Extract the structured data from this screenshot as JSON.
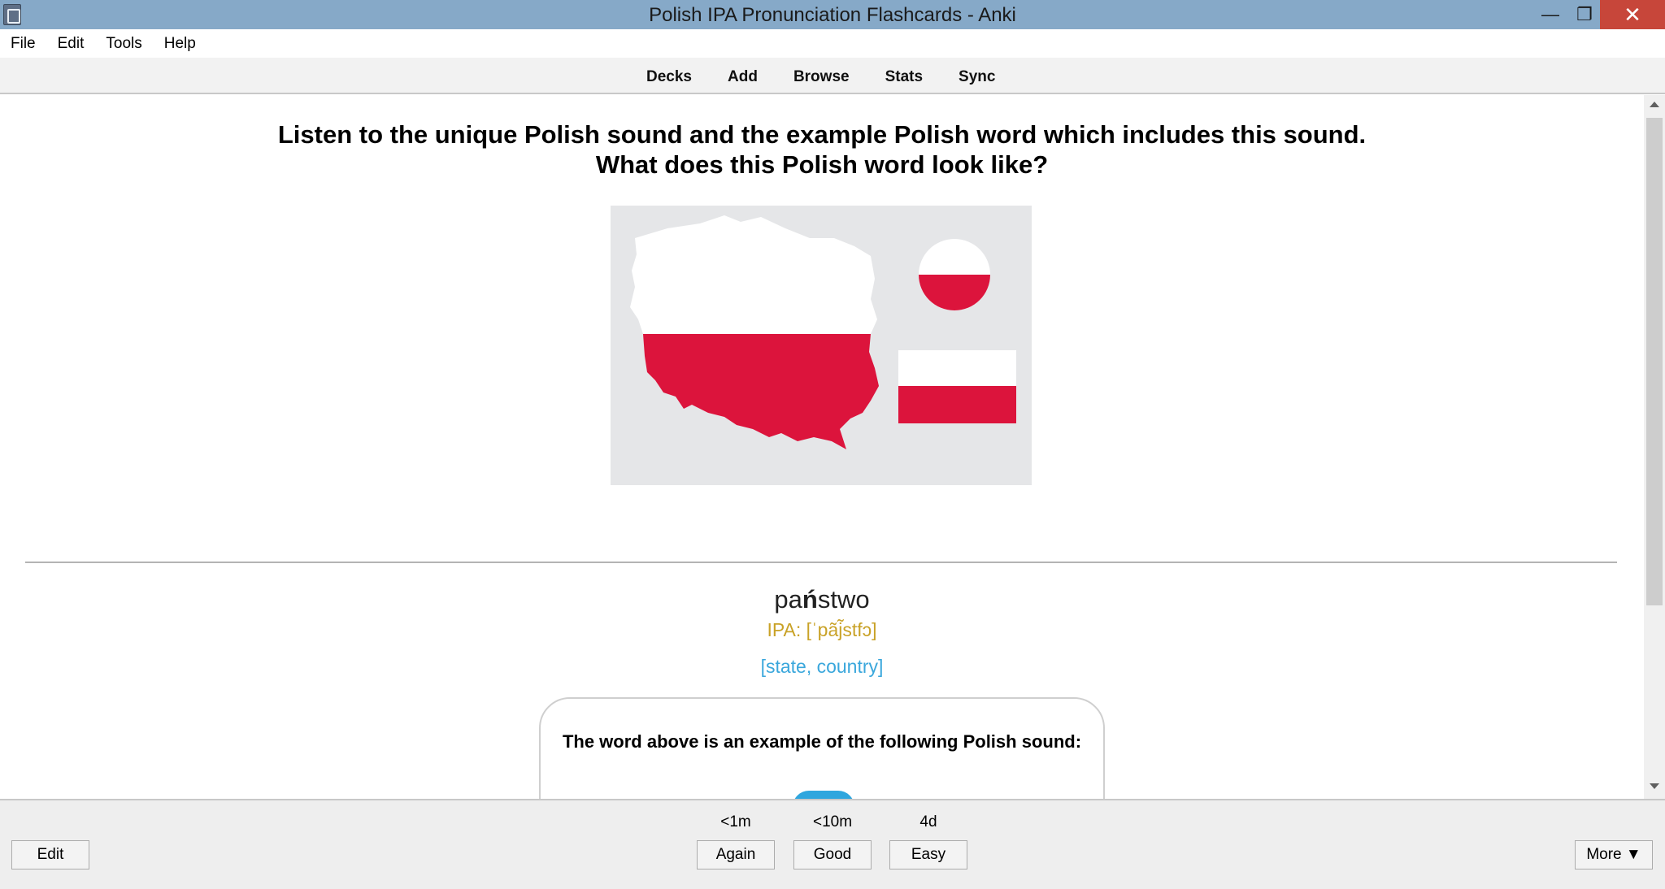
{
  "window": {
    "title": "Polish IPA Pronunciation Flashcards - Anki",
    "controls": {
      "minimize": "—",
      "maximize": "❐",
      "close": "✕"
    }
  },
  "menu": [
    "File",
    "Edit",
    "Tools",
    "Help"
  ],
  "toolbar": [
    "Decks",
    "Add",
    "Browse",
    "Stats",
    "Sync"
  ],
  "card": {
    "question_line1": "Listen to the unique Polish sound and the example Polish word which includes this sound.",
    "question_line2": "What does this Polish word look like?",
    "image": {
      "description_icon": "polish-map-and-flag",
      "colors": {
        "white": "#ffffff",
        "red": "#dc143c",
        "background": "#e5e6e8"
      }
    },
    "word_before": "pa",
    "word_highlight": "ń",
    "word_after": "stwo",
    "ipa": "IPA: [ˈpãj̃stfɔ]",
    "meaning": "[state, country]",
    "sound_box_text": "The word above is an example of the following Polish sound:"
  },
  "colors": {
    "ipa": "#c9a227",
    "meaning": "#3aa7dc",
    "titlebar": "#86a9c8",
    "close": "#c7463a",
    "pill": "#2fa6de"
  },
  "answer_buttons": {
    "edit": "Edit",
    "again": {
      "label": "Again",
      "interval": "<1m"
    },
    "good": {
      "label": "Good",
      "interval": "<10m"
    },
    "easy": {
      "label": "Easy",
      "interval": "4d"
    },
    "more": "More ▼"
  }
}
